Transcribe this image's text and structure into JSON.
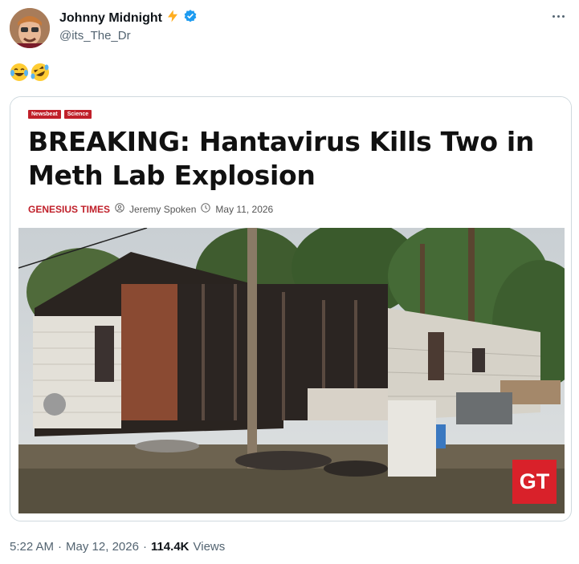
{
  "post": {
    "author_name": "Johnny Midnight",
    "author_handle": "@its_The_Dr",
    "text": "😂🤣",
    "timestamp": "5:22 AM",
    "date": "May 12, 2026",
    "views": "114.4K",
    "views_label": "Views",
    "separator": "·"
  },
  "article": {
    "tags": [
      "Newsbeat",
      "Science"
    ],
    "headline": "BREAKING: Hantavirus Kills Two in Meth Lab Explosion",
    "outlet": "GENESIUS TIMES",
    "author": "Jeremy Spoken",
    "date": "May 11, 2026",
    "badge": "GT"
  },
  "colors": {
    "verified": "#1d9bf0",
    "lightning": "#ffad1f",
    "brand_red": "#c0202a"
  },
  "icons": [
    "lightning-icon",
    "verified-badge-icon",
    "more-options-icon",
    "author-icon",
    "clock-icon"
  ]
}
